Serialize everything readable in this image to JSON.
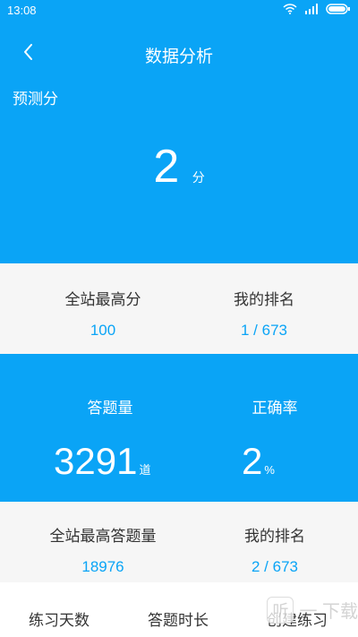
{
  "status_bar": {
    "time": "13:08",
    "icons": [
      "wifi-icon",
      "signal-icon",
      "battery-icon"
    ]
  },
  "header": {
    "title": "数据分析",
    "subtitle": "预测分",
    "score": "2",
    "score_unit": "分"
  },
  "stats_row1": {
    "left_label": "全站最高分",
    "left_value": "100",
    "right_label": "我的排名",
    "right_value": "1 / 673"
  },
  "stats_row2": {
    "left_label": "答题量",
    "left_value": "3291",
    "left_unit": "道",
    "right_label": "正确率",
    "right_value": "2",
    "right_unit": "%"
  },
  "stats_row3": {
    "left_label": "全站最高答题量",
    "left_value": "18976",
    "right_label": "我的排名",
    "right_value": "2 / 673"
  },
  "tabs": [
    {
      "label": "练习天数"
    },
    {
      "label": "答题时长"
    },
    {
      "label": "创建练习"
    }
  ],
  "watermark": {
    "text": "一 下载"
  },
  "colors": {
    "primary": "#0aa4f6",
    "light_bg": "#f6f6f6",
    "text_dark": "#333333"
  }
}
